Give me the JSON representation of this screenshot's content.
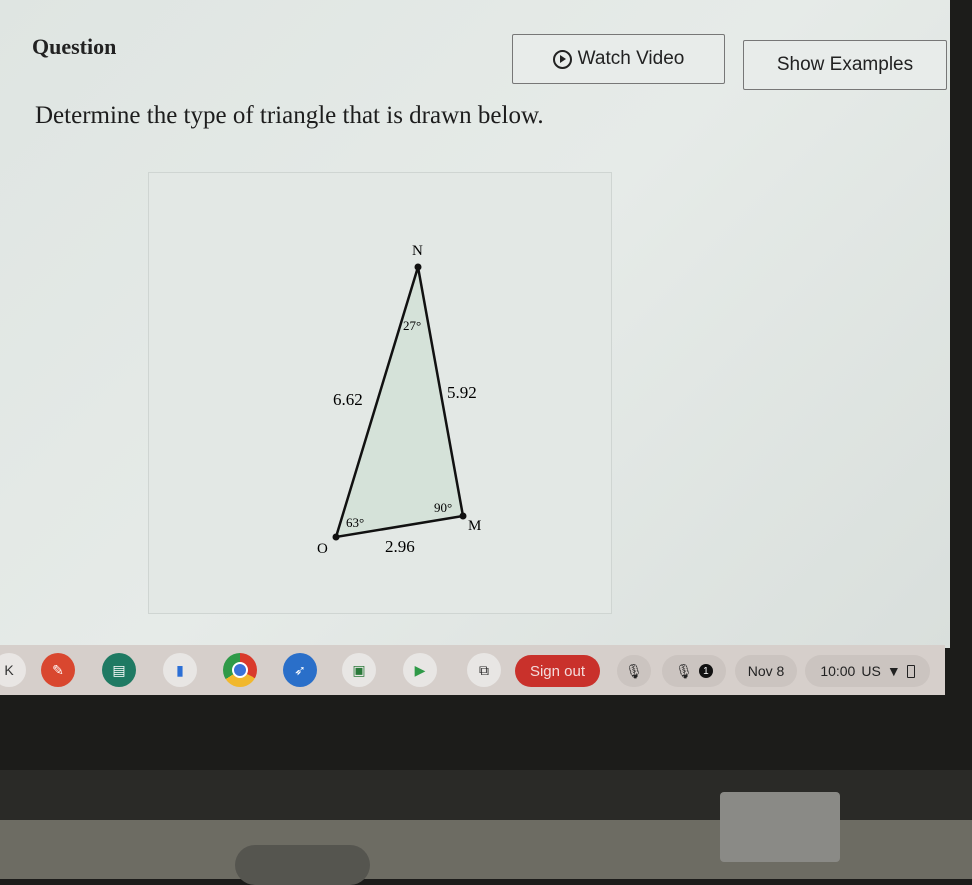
{
  "question": {
    "label": "Question",
    "watch_video": "Watch Video",
    "show_examples": "Show Examples",
    "prompt": "Determine the type of triangle that is drawn below."
  },
  "triangle": {
    "vertices": {
      "N": "N",
      "O": "O",
      "M": "M"
    },
    "angles": {
      "N": "27°",
      "O": "63°",
      "M": "90°"
    },
    "sides": {
      "NO": "6.62",
      "NM": "5.92",
      "OM": "2.96"
    },
    "fill_color": "#d5e2d9"
  },
  "shelf": {
    "apps": [
      "launcher-icon",
      "paint-icon",
      "slides-icon",
      "docs-icon",
      "chrome-icon",
      "rocket-icon",
      "classroom-icon",
      "play-store-icon",
      "screenshot-icon"
    ],
    "sign_out": "Sign out",
    "notification_count": "1",
    "date": "Nov 8",
    "time": "10:00",
    "locale": "US",
    "sign_out_color": "#c9312b"
  }
}
